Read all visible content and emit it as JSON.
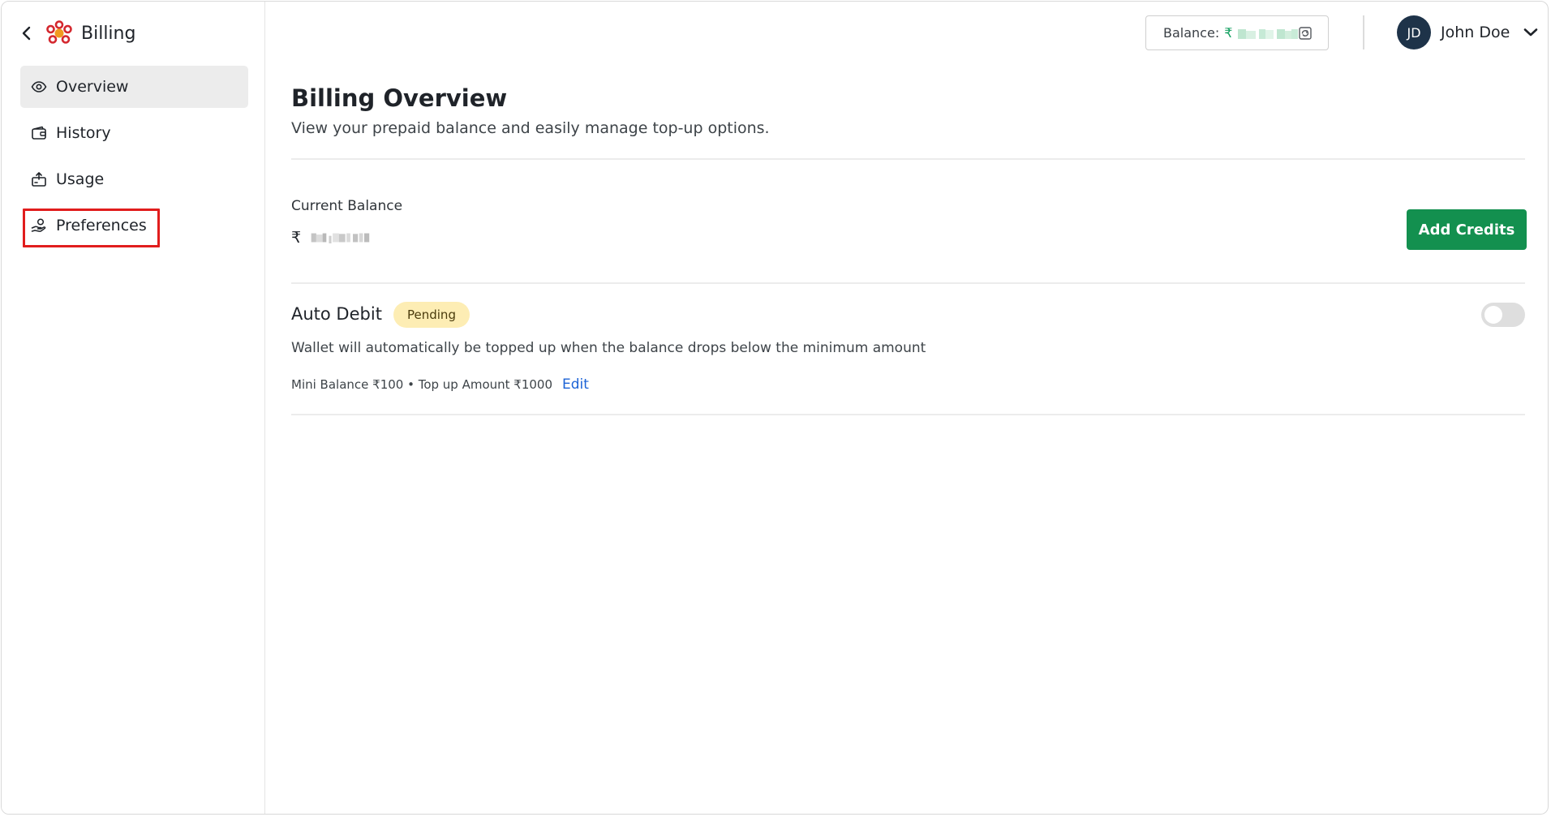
{
  "sidebar": {
    "title": "Billing",
    "items": [
      {
        "label": "Overview",
        "active": true
      },
      {
        "label": "History"
      },
      {
        "label": "Usage"
      },
      {
        "label": "Preferences",
        "highlighted": true
      }
    ]
  },
  "header": {
    "balance_label": "Balance:",
    "balance_currency": "₹",
    "user_initials": "JD",
    "user_name": "John Doe"
  },
  "main": {
    "title": "Billing Overview",
    "subtitle": "View your prepaid balance and easily manage top-up options.",
    "current_balance_label": "Current Balance",
    "current_balance_currency": "₹",
    "add_credits_label": "Add Credits",
    "auto_debit": {
      "title": "Auto Debit",
      "status": "Pending",
      "enabled": false,
      "description": "Wallet will automatically be topped up when the balance drops below the minimum amount",
      "meta": "Mini Balance ₹100 • Top up Amount ₹1000",
      "edit_label": "Edit"
    }
  },
  "colors": {
    "primary_green": "#13904f",
    "balance_green": "#13a060",
    "badge_bg": "#fdedb4",
    "link_blue": "#1c63d6",
    "avatar_bg": "#1e3349",
    "highlight_red": "#e11d1d",
    "logo_red": "#d4282f",
    "logo_orange": "#f19a1f"
  }
}
